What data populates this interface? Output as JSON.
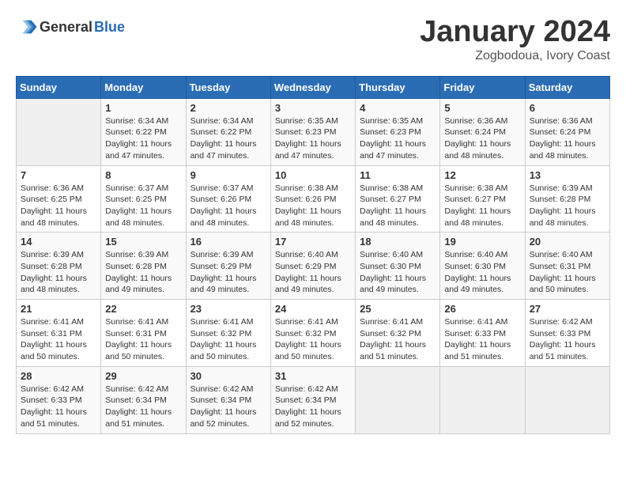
{
  "logo": {
    "general": "General",
    "blue": "Blue"
  },
  "header": {
    "month": "January 2024",
    "location": "Zogbodoua, Ivory Coast"
  },
  "weekdays": [
    "Sunday",
    "Monday",
    "Tuesday",
    "Wednesday",
    "Thursday",
    "Friday",
    "Saturday"
  ],
  "weeks": [
    [
      {
        "day": "",
        "info": ""
      },
      {
        "day": "1",
        "info": "Sunrise: 6:34 AM\nSunset: 6:22 PM\nDaylight: 11 hours\nand 47 minutes."
      },
      {
        "day": "2",
        "info": "Sunrise: 6:34 AM\nSunset: 6:22 PM\nDaylight: 11 hours\nand 47 minutes."
      },
      {
        "day": "3",
        "info": "Sunrise: 6:35 AM\nSunset: 6:23 PM\nDaylight: 11 hours\nand 47 minutes."
      },
      {
        "day": "4",
        "info": "Sunrise: 6:35 AM\nSunset: 6:23 PM\nDaylight: 11 hours\nand 47 minutes."
      },
      {
        "day": "5",
        "info": "Sunrise: 6:36 AM\nSunset: 6:24 PM\nDaylight: 11 hours\nand 48 minutes."
      },
      {
        "day": "6",
        "info": "Sunrise: 6:36 AM\nSunset: 6:24 PM\nDaylight: 11 hours\nand 48 minutes."
      }
    ],
    [
      {
        "day": "7",
        "info": "Sunrise: 6:36 AM\nSunset: 6:25 PM\nDaylight: 11 hours\nand 48 minutes."
      },
      {
        "day": "8",
        "info": "Sunrise: 6:37 AM\nSunset: 6:25 PM\nDaylight: 11 hours\nand 48 minutes."
      },
      {
        "day": "9",
        "info": "Sunrise: 6:37 AM\nSunset: 6:26 PM\nDaylight: 11 hours\nand 48 minutes."
      },
      {
        "day": "10",
        "info": "Sunrise: 6:38 AM\nSunset: 6:26 PM\nDaylight: 11 hours\nand 48 minutes."
      },
      {
        "day": "11",
        "info": "Sunrise: 6:38 AM\nSunset: 6:27 PM\nDaylight: 11 hours\nand 48 minutes."
      },
      {
        "day": "12",
        "info": "Sunrise: 6:38 AM\nSunset: 6:27 PM\nDaylight: 11 hours\nand 48 minutes."
      },
      {
        "day": "13",
        "info": "Sunrise: 6:39 AM\nSunset: 6:28 PM\nDaylight: 11 hours\nand 48 minutes."
      }
    ],
    [
      {
        "day": "14",
        "info": "Sunrise: 6:39 AM\nSunset: 6:28 PM\nDaylight: 11 hours\nand 48 minutes."
      },
      {
        "day": "15",
        "info": "Sunrise: 6:39 AM\nSunset: 6:28 PM\nDaylight: 11 hours\nand 49 minutes."
      },
      {
        "day": "16",
        "info": "Sunrise: 6:39 AM\nSunset: 6:29 PM\nDaylight: 11 hours\nand 49 minutes."
      },
      {
        "day": "17",
        "info": "Sunrise: 6:40 AM\nSunset: 6:29 PM\nDaylight: 11 hours\nand 49 minutes."
      },
      {
        "day": "18",
        "info": "Sunrise: 6:40 AM\nSunset: 6:30 PM\nDaylight: 11 hours\nand 49 minutes."
      },
      {
        "day": "19",
        "info": "Sunrise: 6:40 AM\nSunset: 6:30 PM\nDaylight: 11 hours\nand 49 minutes."
      },
      {
        "day": "20",
        "info": "Sunrise: 6:40 AM\nSunset: 6:31 PM\nDaylight: 11 hours\nand 50 minutes."
      }
    ],
    [
      {
        "day": "21",
        "info": "Sunrise: 6:41 AM\nSunset: 6:31 PM\nDaylight: 11 hours\nand 50 minutes."
      },
      {
        "day": "22",
        "info": "Sunrise: 6:41 AM\nSunset: 6:31 PM\nDaylight: 11 hours\nand 50 minutes."
      },
      {
        "day": "23",
        "info": "Sunrise: 6:41 AM\nSunset: 6:32 PM\nDaylight: 11 hours\nand 50 minutes."
      },
      {
        "day": "24",
        "info": "Sunrise: 6:41 AM\nSunset: 6:32 PM\nDaylight: 11 hours\nand 50 minutes."
      },
      {
        "day": "25",
        "info": "Sunrise: 6:41 AM\nSunset: 6:32 PM\nDaylight: 11 hours\nand 51 minutes."
      },
      {
        "day": "26",
        "info": "Sunrise: 6:41 AM\nSunset: 6:33 PM\nDaylight: 11 hours\nand 51 minutes."
      },
      {
        "day": "27",
        "info": "Sunrise: 6:42 AM\nSunset: 6:33 PM\nDaylight: 11 hours\nand 51 minutes."
      }
    ],
    [
      {
        "day": "28",
        "info": "Sunrise: 6:42 AM\nSunset: 6:33 PM\nDaylight: 11 hours\nand 51 minutes."
      },
      {
        "day": "29",
        "info": "Sunrise: 6:42 AM\nSunset: 6:34 PM\nDaylight: 11 hours\nand 51 minutes."
      },
      {
        "day": "30",
        "info": "Sunrise: 6:42 AM\nSunset: 6:34 PM\nDaylight: 11 hours\nand 52 minutes."
      },
      {
        "day": "31",
        "info": "Sunrise: 6:42 AM\nSunset: 6:34 PM\nDaylight: 11 hours\nand 52 minutes."
      },
      {
        "day": "",
        "info": ""
      },
      {
        "day": "",
        "info": ""
      },
      {
        "day": "",
        "info": ""
      }
    ]
  ]
}
